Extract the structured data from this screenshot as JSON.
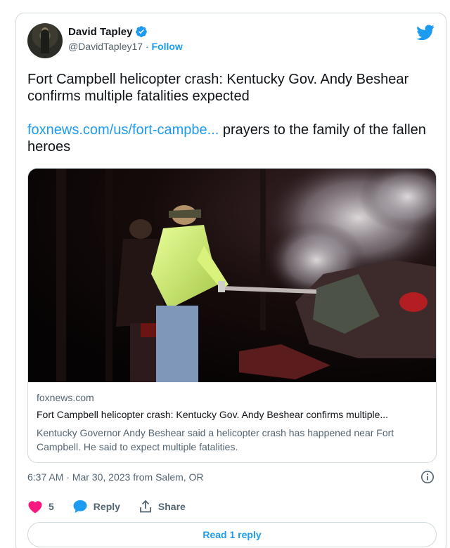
{
  "author": {
    "name": "David Tapley",
    "handle": "@DavidTapley17",
    "separator": " · ",
    "follow_label": "Follow"
  },
  "tweet": {
    "line1": "Fort Campbell helicopter crash: Kentucky Gov. Andy Beshear confirms multiple fatalities expected",
    "link_text": "foxnews.com/us/fort-campbe...",
    "line2_rest": " prayers to the family of the fallen heroes"
  },
  "link_card": {
    "domain": "foxnews.com",
    "title": "Fort Campbell helicopter crash: Kentucky Gov. Andy Beshear confirms multiple...",
    "description": "Kentucky Governor Andy Beshear said a helicopter crash has happened near Fort Campbell. He said to expect multiple fatalities."
  },
  "timestamp": "6:37 AM · Mar 30, 2023 from Salem, OR",
  "actions": {
    "like_count": "5",
    "reply_label": "Reply",
    "share_label": "Share"
  },
  "read_reply_label": "Read 1 reply",
  "colors": {
    "accent": "#1d9bf0",
    "like": "#f91880",
    "text": "#0f1419",
    "secondary_text": "#536471",
    "border": "#cfd9de"
  },
  "icons": [
    "verified-badge-icon",
    "twitter-bird-icon",
    "info-icon",
    "heart-icon",
    "reply-bubble-icon",
    "share-icon"
  ]
}
